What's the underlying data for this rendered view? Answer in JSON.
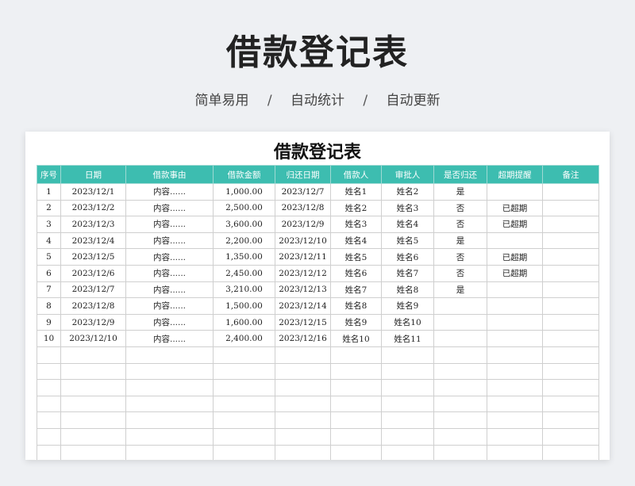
{
  "page": {
    "title": "借款登记表",
    "taglines": [
      "简单易用",
      "自动统计",
      "自动更新"
    ],
    "separator": "/"
  },
  "sheet": {
    "title": "借款登记表",
    "header_color": "#3dbdb0",
    "columns": [
      "序号",
      "日期",
      "借款事由",
      "借款金额",
      "归还日期",
      "借款人",
      "审批人",
      "是否归还",
      "超期提醒",
      "备注"
    ],
    "rows": [
      [
        "1",
        "2023/12/1",
        "内容......",
        "1,000.00",
        "2023/12/7",
        "姓名1",
        "姓名2",
        "是",
        "",
        ""
      ],
      [
        "2",
        "2023/12/2",
        "内容......",
        "2,500.00",
        "2023/12/8",
        "姓名2",
        "姓名3",
        "否",
        "已超期",
        ""
      ],
      [
        "3",
        "2023/12/3",
        "内容......",
        "3,600.00",
        "2023/12/9",
        "姓名3",
        "姓名4",
        "否",
        "已超期",
        ""
      ],
      [
        "4",
        "2023/12/4",
        "内容......",
        "2,200.00",
        "2023/12/10",
        "姓名4",
        "姓名5",
        "是",
        "",
        ""
      ],
      [
        "5",
        "2023/12/5",
        "内容......",
        "1,350.00",
        "2023/12/11",
        "姓名5",
        "姓名6",
        "否",
        "已超期",
        ""
      ],
      [
        "6",
        "2023/12/6",
        "内容......",
        "2,450.00",
        "2023/12/12",
        "姓名6",
        "姓名7",
        "否",
        "已超期",
        ""
      ],
      [
        "7",
        "2023/12/7",
        "内容......",
        "3,210.00",
        "2023/12/13",
        "姓名7",
        "姓名8",
        "是",
        "",
        ""
      ],
      [
        "8",
        "2023/12/8",
        "内容......",
        "1,500.00",
        "2023/12/14",
        "姓名8",
        "姓名9",
        "",
        "",
        ""
      ],
      [
        "9",
        "2023/12/9",
        "内容......",
        "1,600.00",
        "2023/12/15",
        "姓名9",
        "姓名10",
        "",
        "",
        ""
      ],
      [
        "10",
        "2023/12/10",
        "内容......",
        "2,400.00",
        "2023/12/16",
        "姓名10",
        "姓名11",
        "",
        "",
        ""
      ],
      [
        "",
        "",
        "",
        "",
        "",
        "",
        "",
        "",
        "",
        ""
      ],
      [
        "",
        "",
        "",
        "",
        "",
        "",
        "",
        "",
        "",
        ""
      ],
      [
        "",
        "",
        "",
        "",
        "",
        "",
        "",
        "",
        "",
        ""
      ],
      [
        "",
        "",
        "",
        "",
        "",
        "",
        "",
        "",
        "",
        ""
      ],
      [
        "",
        "",
        "",
        "",
        "",
        "",
        "",
        "",
        "",
        ""
      ],
      [
        "",
        "",
        "",
        "",
        "",
        "",
        "",
        "",
        "",
        ""
      ],
      [
        "",
        "",
        "",
        "",
        "",
        "",
        "",
        "",
        "",
        ""
      ]
    ]
  }
}
